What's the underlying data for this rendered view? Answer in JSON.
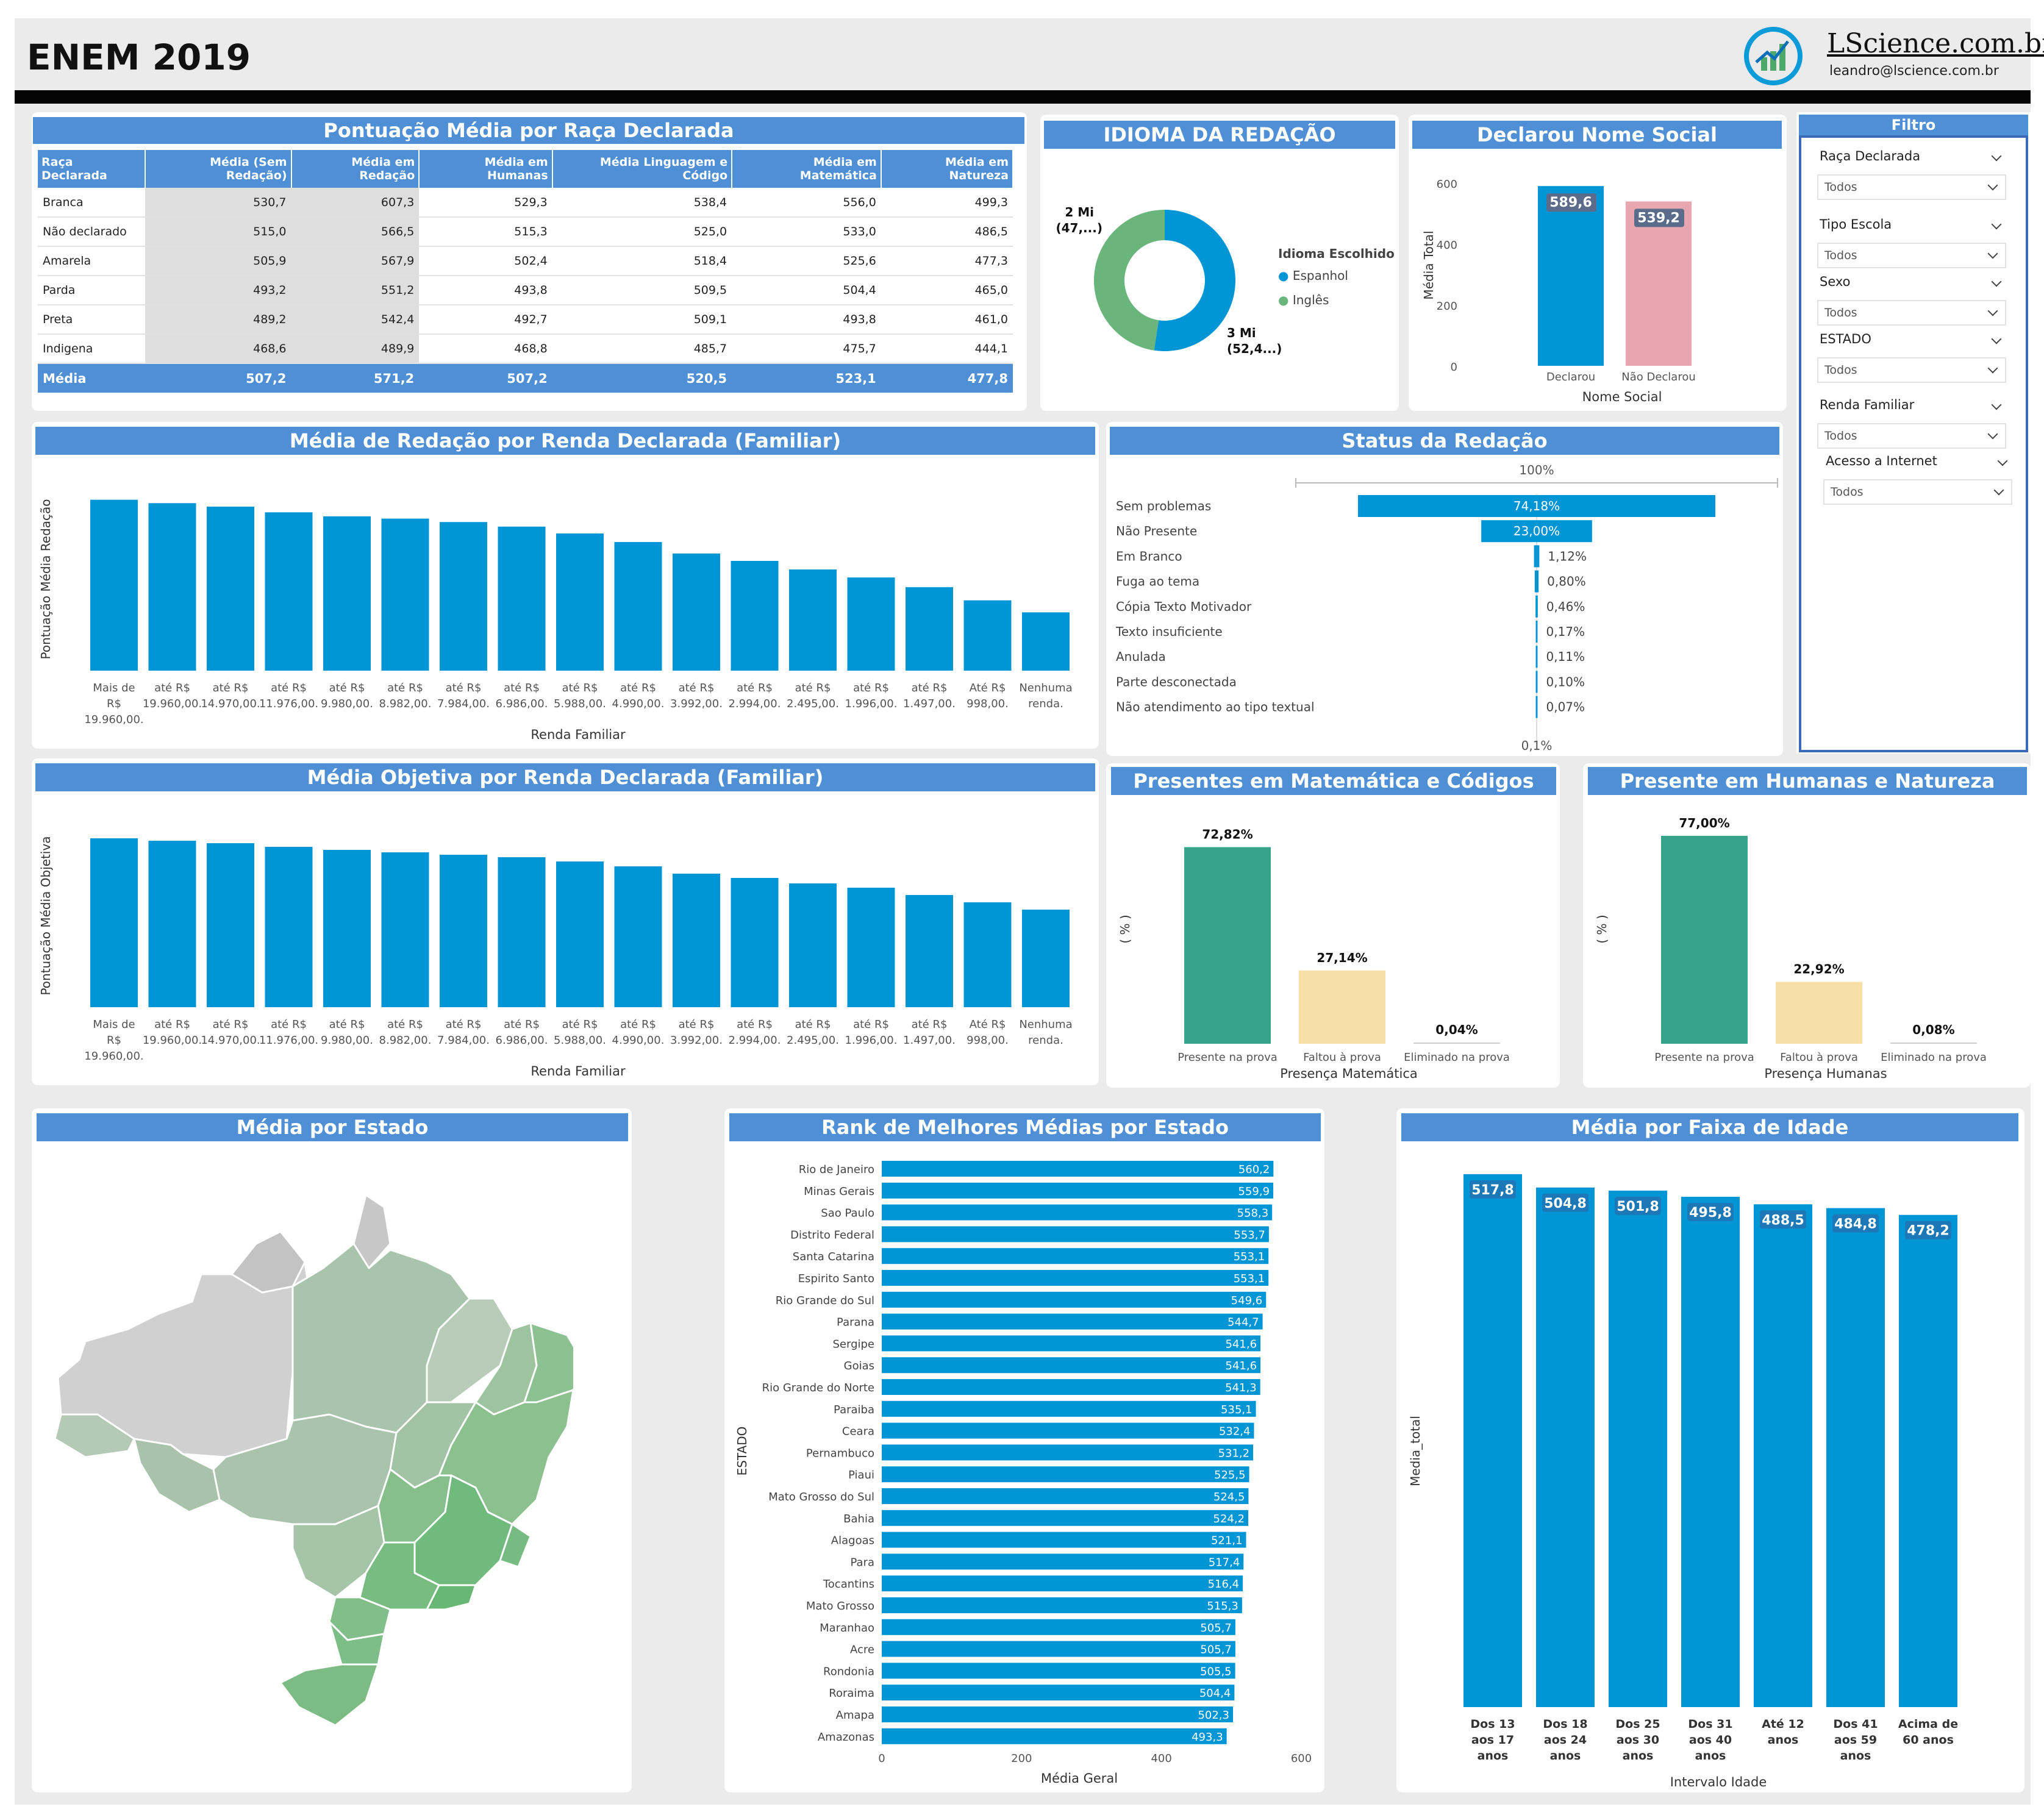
{
  "header": {
    "title": "ENEM 2019",
    "brand": "LScience.com.br",
    "email": "leandro@lscience.com.br"
  },
  "race_table": {
    "title": "Pontuação Média por Raça Declarada",
    "columns": [
      "Raça Declarada",
      "Média (Sem Redação)",
      "Média em Redação",
      "Média em Humanas",
      "Média Linguagem e Código",
      "Média em Matemática",
      "Média em Natureza"
    ],
    "rows": [
      [
        "Branca",
        "530,7",
        "607,3",
        "529,3",
        "538,4",
        "556,0",
        "499,3"
      ],
      [
        "Não declarado",
        "515,0",
        "566,5",
        "515,3",
        "525,0",
        "533,0",
        "486,5"
      ],
      [
        "Amarela",
        "505,9",
        "567,9",
        "502,4",
        "518,4",
        "525,6",
        "477,3"
      ],
      [
        "Parda",
        "493,2",
        "551,2",
        "493,8",
        "509,5",
        "504,4",
        "465,0"
      ],
      [
        "Preta",
        "489,2",
        "542,4",
        "492,7",
        "509,1",
        "493,8",
        "461,0"
      ],
      [
        "Indigena",
        "468,6",
        "489,9",
        "468,8",
        "485,7",
        "475,7",
        "444,1"
      ]
    ],
    "total": [
      "Média",
      "507,2",
      "571,2",
      "507,2",
      "520,5",
      "523,1",
      "477,8"
    ]
  },
  "idioma": {
    "title": "IDIOMA DA REDAÇÃO",
    "legend_title": "Idioma Escolhido",
    "label_top_1": "2 Mi",
    "label_top_2": "(47,...)",
    "label_bot_1": "3 Mi",
    "label_bot_2": "(52,4...)",
    "chart_data": {
      "type": "pie",
      "categories": [
        "Espanhol",
        "Inglês"
      ],
      "values": [
        52.4,
        47.6
      ],
      "colors": [
        "#0096d6",
        "#6ab57c"
      ]
    }
  },
  "nome_social": {
    "title": "Declarou Nome Social",
    "chart_data": {
      "type": "bar",
      "categories": [
        "Declarou",
        "Não Declarou"
      ],
      "values": [
        589.6,
        539.2
      ],
      "value_labels": [
        "589,6",
        "539,2"
      ],
      "colors": [
        "#0096d6",
        "#e8a6b0"
      ],
      "ylim": [
        0,
        600
      ],
      "yticks": [
        "0",
        "200",
        "400",
        "600"
      ],
      "xlabel": "Nome Social",
      "ylabel": "Média Total"
    }
  },
  "filter": {
    "title": "Filtro",
    "slicers": [
      {
        "label": "Raça Declarada",
        "value": "Todos"
      },
      {
        "label": "Tipo Escola",
        "value": "Todos"
      },
      {
        "label": "Sexo",
        "value": "Todos"
      },
      {
        "label": "ESTADO",
        "value": "Todos"
      },
      {
        "label": "Renda Familiar",
        "value": "Todos"
      },
      {
        "label": "Acesso a Internet",
        "value": "Todos"
      }
    ]
  },
  "redacao_renda": {
    "title": "Média de Redação por Renda Declarada (Familiar)",
    "chart_data": {
      "type": "bar",
      "xlabel": "Renda Familiar",
      "ylabel": "Pontuação Média Redação",
      "categories": [
        "Mais de R$ 19.960,00.",
        "até R$ 19.960,00.",
        "até R$ 14.970,00.",
        "até R$ 11.976,00.",
        "até R$ 9.980,00.",
        "até R$ 8.982,00.",
        "até R$ 7.984,00.",
        "até R$ 6.986,00.",
        "até R$ 5.988,00.",
        "até R$ 4.990,00.",
        "até R$ 3.992,00.",
        "até R$ 2.994,00.",
        "até R$ 2.495,00.",
        "até R$ 1.996,00.",
        "até R$ 1.497,00.",
        "Até R$ 998,00.",
        "Nenhuma renda."
      ],
      "values": [
        719,
        713,
        707,
        697,
        690,
        686,
        680,
        672,
        660,
        645,
        625,
        612,
        597,
        583,
        566,
        543,
        522
      ],
      "ylim": [
        0,
        740
      ]
    }
  },
  "status_redacao": {
    "title": "Status da Redação",
    "top_label": "100%",
    "bottom_label": "0,1%",
    "chart_data": {
      "type": "bar",
      "categories": [
        "Sem problemas",
        "Não Presente",
        "Em Branco",
        "Fuga ao tema",
        "Cópia Texto Motivador",
        "Texto insuficiente",
        "Anulada",
        "Parte desconectada",
        "Não atendimento ao tipo textual"
      ],
      "values": [
        74.18,
        23.0,
        1.12,
        0.8,
        0.46,
        0.17,
        0.11,
        0.1,
        0.07
      ],
      "value_labels": [
        "74,18%",
        "23,00%",
        "1,12%",
        "0,80%",
        "0,46%",
        "0,17%",
        "0,11%",
        "0,10%",
        "0,07%"
      ]
    }
  },
  "objetiva_renda": {
    "title": "Média Objetiva por Renda Declarada (Familiar)",
    "chart_data": {
      "type": "bar",
      "xlabel": "Renda Familiar",
      "ylabel": "Pontuação Média Objetiva",
      "categories": [
        "Mais de R$ 19.960,00.",
        "até R$ 19.960,00.",
        "até R$ 14.970,00.",
        "até R$ 11.976,00.",
        "até R$ 9.980,00.",
        "até R$ 8.982,00.",
        "até R$ 7.984,00.",
        "até R$ 6.986,00.",
        "até R$ 5.988,00.",
        "até R$ 4.990,00.",
        "até R$ 3.992,00.",
        "até R$ 2.994,00.",
        "até R$ 2.495,00.",
        "até R$ 1.996,00.",
        "até R$ 1.497,00.",
        "Até R$ 998,00.",
        "Nenhuma renda."
      ],
      "values": [
        617,
        613,
        609,
        603,
        598,
        594,
        590,
        586,
        579,
        571,
        559,
        552,
        543,
        536,
        524,
        512,
        500
      ],
      "ylim": [
        0,
        640
      ]
    }
  },
  "presentes_mat": {
    "title": "Presentes em Matemática e Códigos",
    "chart_data": {
      "type": "bar",
      "categories": [
        "Presente na prova",
        "Faltou à prova",
        "Eliminado na prova"
      ],
      "values": [
        72.82,
        27.14,
        0.04
      ],
      "value_labels": [
        "72,82%",
        "27,14%",
        "0,04%"
      ],
      "colors": [
        "#37a38b",
        "#f7dfa6",
        "#cfcfcf"
      ],
      "xlabel": "Presença Matemática",
      "ylabel": "( % )"
    }
  },
  "presentes_hum": {
    "title": "Presente em Humanas e Natureza",
    "chart_data": {
      "type": "bar",
      "categories": [
        "Presente na prova",
        "Faltou à prova",
        "Eliminado na prova"
      ],
      "values": [
        77.0,
        22.92,
        0.08
      ],
      "value_labels": [
        "77,00%",
        "22,92%",
        "0,08%"
      ],
      "colors": [
        "#37a38b",
        "#f7dfa6",
        "#cfcfcf"
      ],
      "xlabel": "Presença Humanas",
      "ylabel": "( % )"
    }
  },
  "mapa": {
    "title": "Média por Estado"
  },
  "rank": {
    "title": "Rank de Melhores Médias por Estado",
    "chart_data": {
      "type": "bar",
      "xlabel": "Média Geral",
      "ylabel": "ESTADO",
      "xlim": [
        0,
        600
      ],
      "xticks": [
        "0",
        "200",
        "400",
        "600"
      ],
      "categories": [
        "Rio de Janeiro",
        "Minas Gerais",
        "Sao Paulo",
        "Distrito Federal",
        "Santa Catarina",
        "Espirito Santo",
        "Rio Grande do Sul",
        "Parana",
        "Sergipe",
        "Goias",
        "Rio Grande do Norte",
        "Paraiba",
        "Ceara",
        "Pernambuco",
        "Piaui",
        "Mato Grosso do Sul",
        "Bahia",
        "Alagoas",
        "Para",
        "Tocantins",
        "Mato Grosso",
        "Maranhao",
        "Acre",
        "Rondonia",
        "Roraima",
        "Amapa",
        "Amazonas"
      ],
      "values": [
        560.2,
        559.9,
        558.3,
        553.7,
        553.1,
        553.1,
        549.6,
        544.7,
        541.6,
        541.6,
        541.3,
        535.1,
        532.4,
        531.2,
        525.5,
        524.5,
        524.2,
        521.1,
        517.4,
        516.4,
        515.3,
        505.7,
        505.7,
        505.5,
        504.4,
        502.3,
        493.3
      ],
      "value_labels": [
        "560,2",
        "559,9",
        "558,3",
        "553,7",
        "553,1",
        "553,1",
        "549,6",
        "544,7",
        "541,6",
        "541,6",
        "541,3",
        "535,1",
        "532,4",
        "531,2",
        "525,5",
        "524,5",
        "524,2",
        "521,1",
        "517,4",
        "516,4",
        "515,3",
        "505,7",
        "505,7",
        "505,5",
        "504,4",
        "502,3",
        "493,3"
      ]
    }
  },
  "idade": {
    "title": "Média por Faixa de Idade",
    "chart_data": {
      "type": "bar",
      "xlabel": "Intervalo Idade",
      "ylabel": "Media_total",
      "categories": [
        "Dos 13 aos 17 anos",
        "Dos 18 aos 24 anos",
        "Dos 25 aos 30 anos",
        "Dos 31 aos 40 anos",
        "Até 12 anos",
        "Dos 41 aos 59 anos",
        "Acima de 60 anos"
      ],
      "values": [
        517.8,
        504.8,
        501.8,
        495.8,
        488.5,
        484.8,
        478.2
      ],
      "value_labels": [
        "517,8",
        "504,8",
        "501,8",
        "495,8",
        "488,5",
        "484,8",
        "478,2"
      ]
    }
  }
}
